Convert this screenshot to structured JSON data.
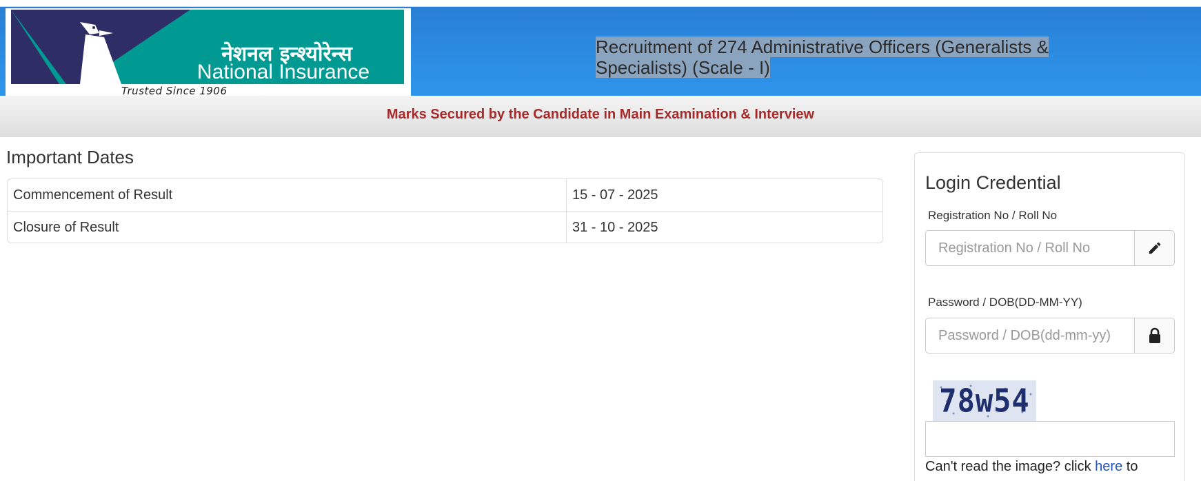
{
  "logo": {
    "hindi_name": "नेशनल इन्श्योरेन्स",
    "english_name": "National Insurance",
    "tagline": "Trusted Since 1906"
  },
  "header": {
    "title": "Recruitment of 274 Administrative Officers (Generalists & Specialists) (Scale - I)"
  },
  "subheader": {
    "text": "Marks Secured by the Candidate in Main Examination & Interview"
  },
  "important_dates": {
    "title": "Important Dates",
    "rows": [
      {
        "label": "Commencement of Result",
        "value": "15 - 07 - 2025"
      },
      {
        "label": "Closure of Result",
        "value": "31 - 10 - 2025"
      }
    ]
  },
  "login": {
    "title": "Login Credential",
    "registration_label": "Registration No / Roll No",
    "registration_placeholder": "Registration No / Roll No",
    "registration_value": "",
    "password_label": "Password / DOB(DD-MM-YY)",
    "password_placeholder": "Password / DOB(dd-mm-yy)",
    "password_value": "",
    "captcha_text": "78w54",
    "captcha_value": "",
    "captcha_help_prefix": "Can't read the image? click ",
    "captcha_help_link": "here",
    "captcha_help_suffix": " to"
  },
  "icons": {
    "registration_addon": "pencil-icon",
    "password_addon": "lock-icon"
  },
  "colors": {
    "header_blue": "#2b8de3",
    "logo_teal": "#009a93",
    "logo_navy": "#2e2d66",
    "subheader_text": "#a52a2a",
    "link": "#2255bb"
  }
}
